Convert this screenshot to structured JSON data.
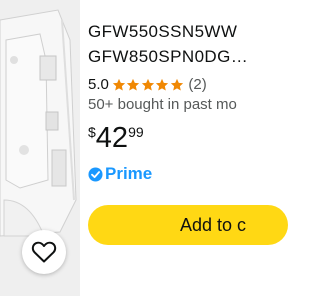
{
  "product": {
    "title_line1": "GFW550SSN5WW",
    "title_line2": "GFW850SPN0DG…",
    "rating_value": "5.0",
    "rating_stars": 5,
    "rating_count": "(2)",
    "bought_text": "50+ bought in past mo",
    "price": {
      "symbol": "$",
      "whole": "42",
      "fraction": "99"
    },
    "prime_label": "Prime",
    "add_button_label": "Add to c"
  },
  "colors": {
    "star": "#f08804",
    "prime": "#1a98ff",
    "button": "#ffd814",
    "image_bg": "#efefef"
  },
  "icons": [
    "heart-icon",
    "prime-check-icon",
    "star-icon"
  ]
}
